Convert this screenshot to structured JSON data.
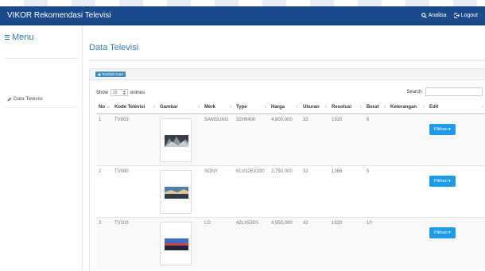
{
  "navbar": {
    "brand": "VIKOR Rekomendasi Televisi",
    "analisa_label": "Analisa",
    "logout_label": "Logout"
  },
  "sidebar": {
    "menu_title": "Menu",
    "items": [
      {
        "label": "Data Televisi"
      }
    ]
  },
  "main": {
    "title": "Data Televisi",
    "add_button_label": "Tambah Data",
    "show_label": "Show",
    "entries_value": "10",
    "entries_label": "entries",
    "search_label": "Search:",
    "search_value": ""
  },
  "table": {
    "headers": [
      "No",
      "Kode Televisi",
      "Gambar",
      "Merk",
      "Type",
      "Harga",
      "Ukuran",
      "Resolusi",
      "Berat",
      "Keterangan",
      "Edit"
    ],
    "rows": [
      {
        "no": "1",
        "kode": "TV003",
        "merk": "SAMSUNG",
        "type": "32H6400",
        "harga": "4,800,000",
        "ukuran": "32",
        "resolusi": "1920",
        "berat": "6",
        "keterangan": "",
        "edit": "Pilihan"
      },
      {
        "no": "2",
        "kode": "TV080",
        "merk": "SONY",
        "type": "KLV32EX330",
        "harga": "2,750,000",
        "ukuran": "32",
        "resolusi": "1366",
        "berat": "5",
        "keterangan": "",
        "edit": "Pilihan"
      },
      {
        "no": "3",
        "kode": "TV103",
        "merk": "LG",
        "type": "42LX530S",
        "harga": "4,950,000",
        "ukuran": "42",
        "resolusi": "1920",
        "berat": "10",
        "keterangan": "",
        "edit": "Pilihan"
      }
    ]
  },
  "colors": {
    "navbar": "#1a4a8a",
    "link": "#337ab7",
    "edit_button": "#1e9be8"
  }
}
